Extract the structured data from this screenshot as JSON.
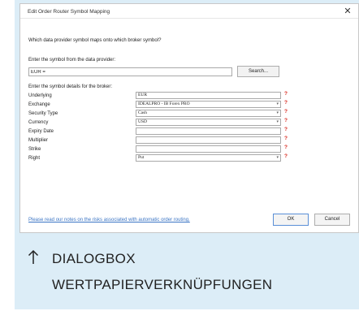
{
  "dialog": {
    "title": "Edit Order Router Symbol Mapping",
    "question": "Which data provider symbol maps onto which broker symbol?",
    "provider_label": "Enter the symbol from the data provider:",
    "provider_value": "EUR =",
    "search_label": "Search...",
    "details_label": "Enter the symbol details for the broker:",
    "rows": [
      {
        "label": "Underlying",
        "value": "EUR",
        "dropdown": false
      },
      {
        "label": "Exchange",
        "value": "IDEALPRO - IB Forex PRO",
        "dropdown": true
      },
      {
        "label": "Security Type",
        "value": "Cash",
        "dropdown": true
      },
      {
        "label": "Currency",
        "value": "USD",
        "dropdown": true
      },
      {
        "label": "Expiry Date",
        "value": "",
        "dropdown": false
      },
      {
        "label": "Multiplier",
        "value": "",
        "dropdown": false
      },
      {
        "label": "Strike",
        "value": "",
        "dropdown": false
      },
      {
        "label": "Right",
        "value": "Put",
        "dropdown": true
      }
    ],
    "required_marker": "?",
    "risk_link": "Please read our notes on the risks associated with automatic order routing.",
    "ok_label": "OK",
    "cancel_label": "Cancel"
  },
  "caption": {
    "line1": "DIALOGBOX",
    "line2": "WERTPAPIERVERKNÜPFUNGEN"
  },
  "colors": {
    "panel_bg": "#dcedf7",
    "required": "#d8281e",
    "link": "#3a74c4",
    "caption_arrow": "#222222"
  },
  "icons": {
    "close": "close-icon",
    "dropdown": "chevron-down-icon",
    "caption_arrow": "arrow-up-icon"
  }
}
